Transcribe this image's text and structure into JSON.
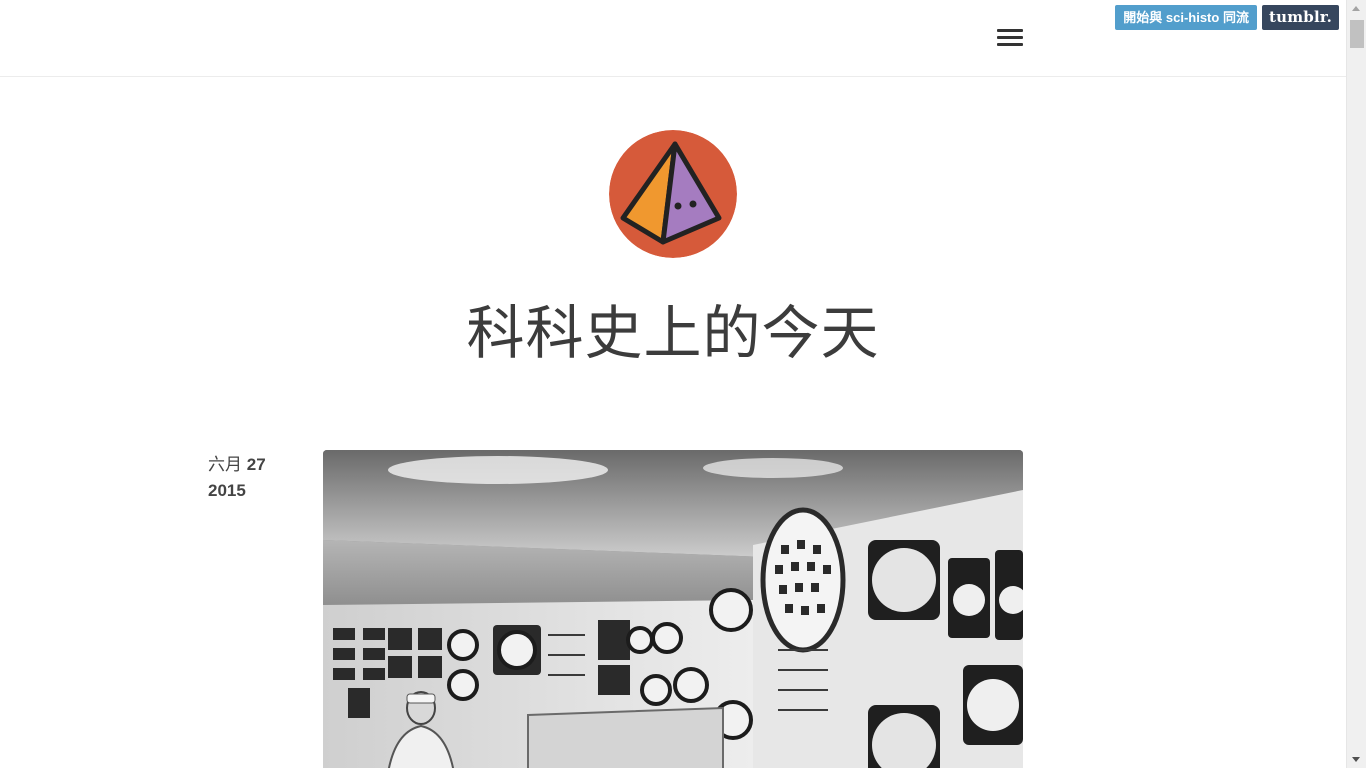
{
  "header": {
    "menu_icon": "hamburger-menu-icon"
  },
  "tumblr_controls": {
    "join_label": "開始與 sci-histo 同流",
    "tumblr_logo": "tumblr.",
    "join_color": "#529ecc",
    "logo_color": "#36465d"
  },
  "blog": {
    "avatar_icon": "pyramid-avatar-icon",
    "avatar_colors": {
      "background": "#d65a3a",
      "left_face": "#f0982f",
      "right_face": "#a57cc0",
      "outline": "#222222"
    },
    "title": "科科史上的今天"
  },
  "post": {
    "date_month_day": "六月",
    "date_day": "27",
    "date_year": "2015",
    "photo_icon": "control-room-photo"
  }
}
